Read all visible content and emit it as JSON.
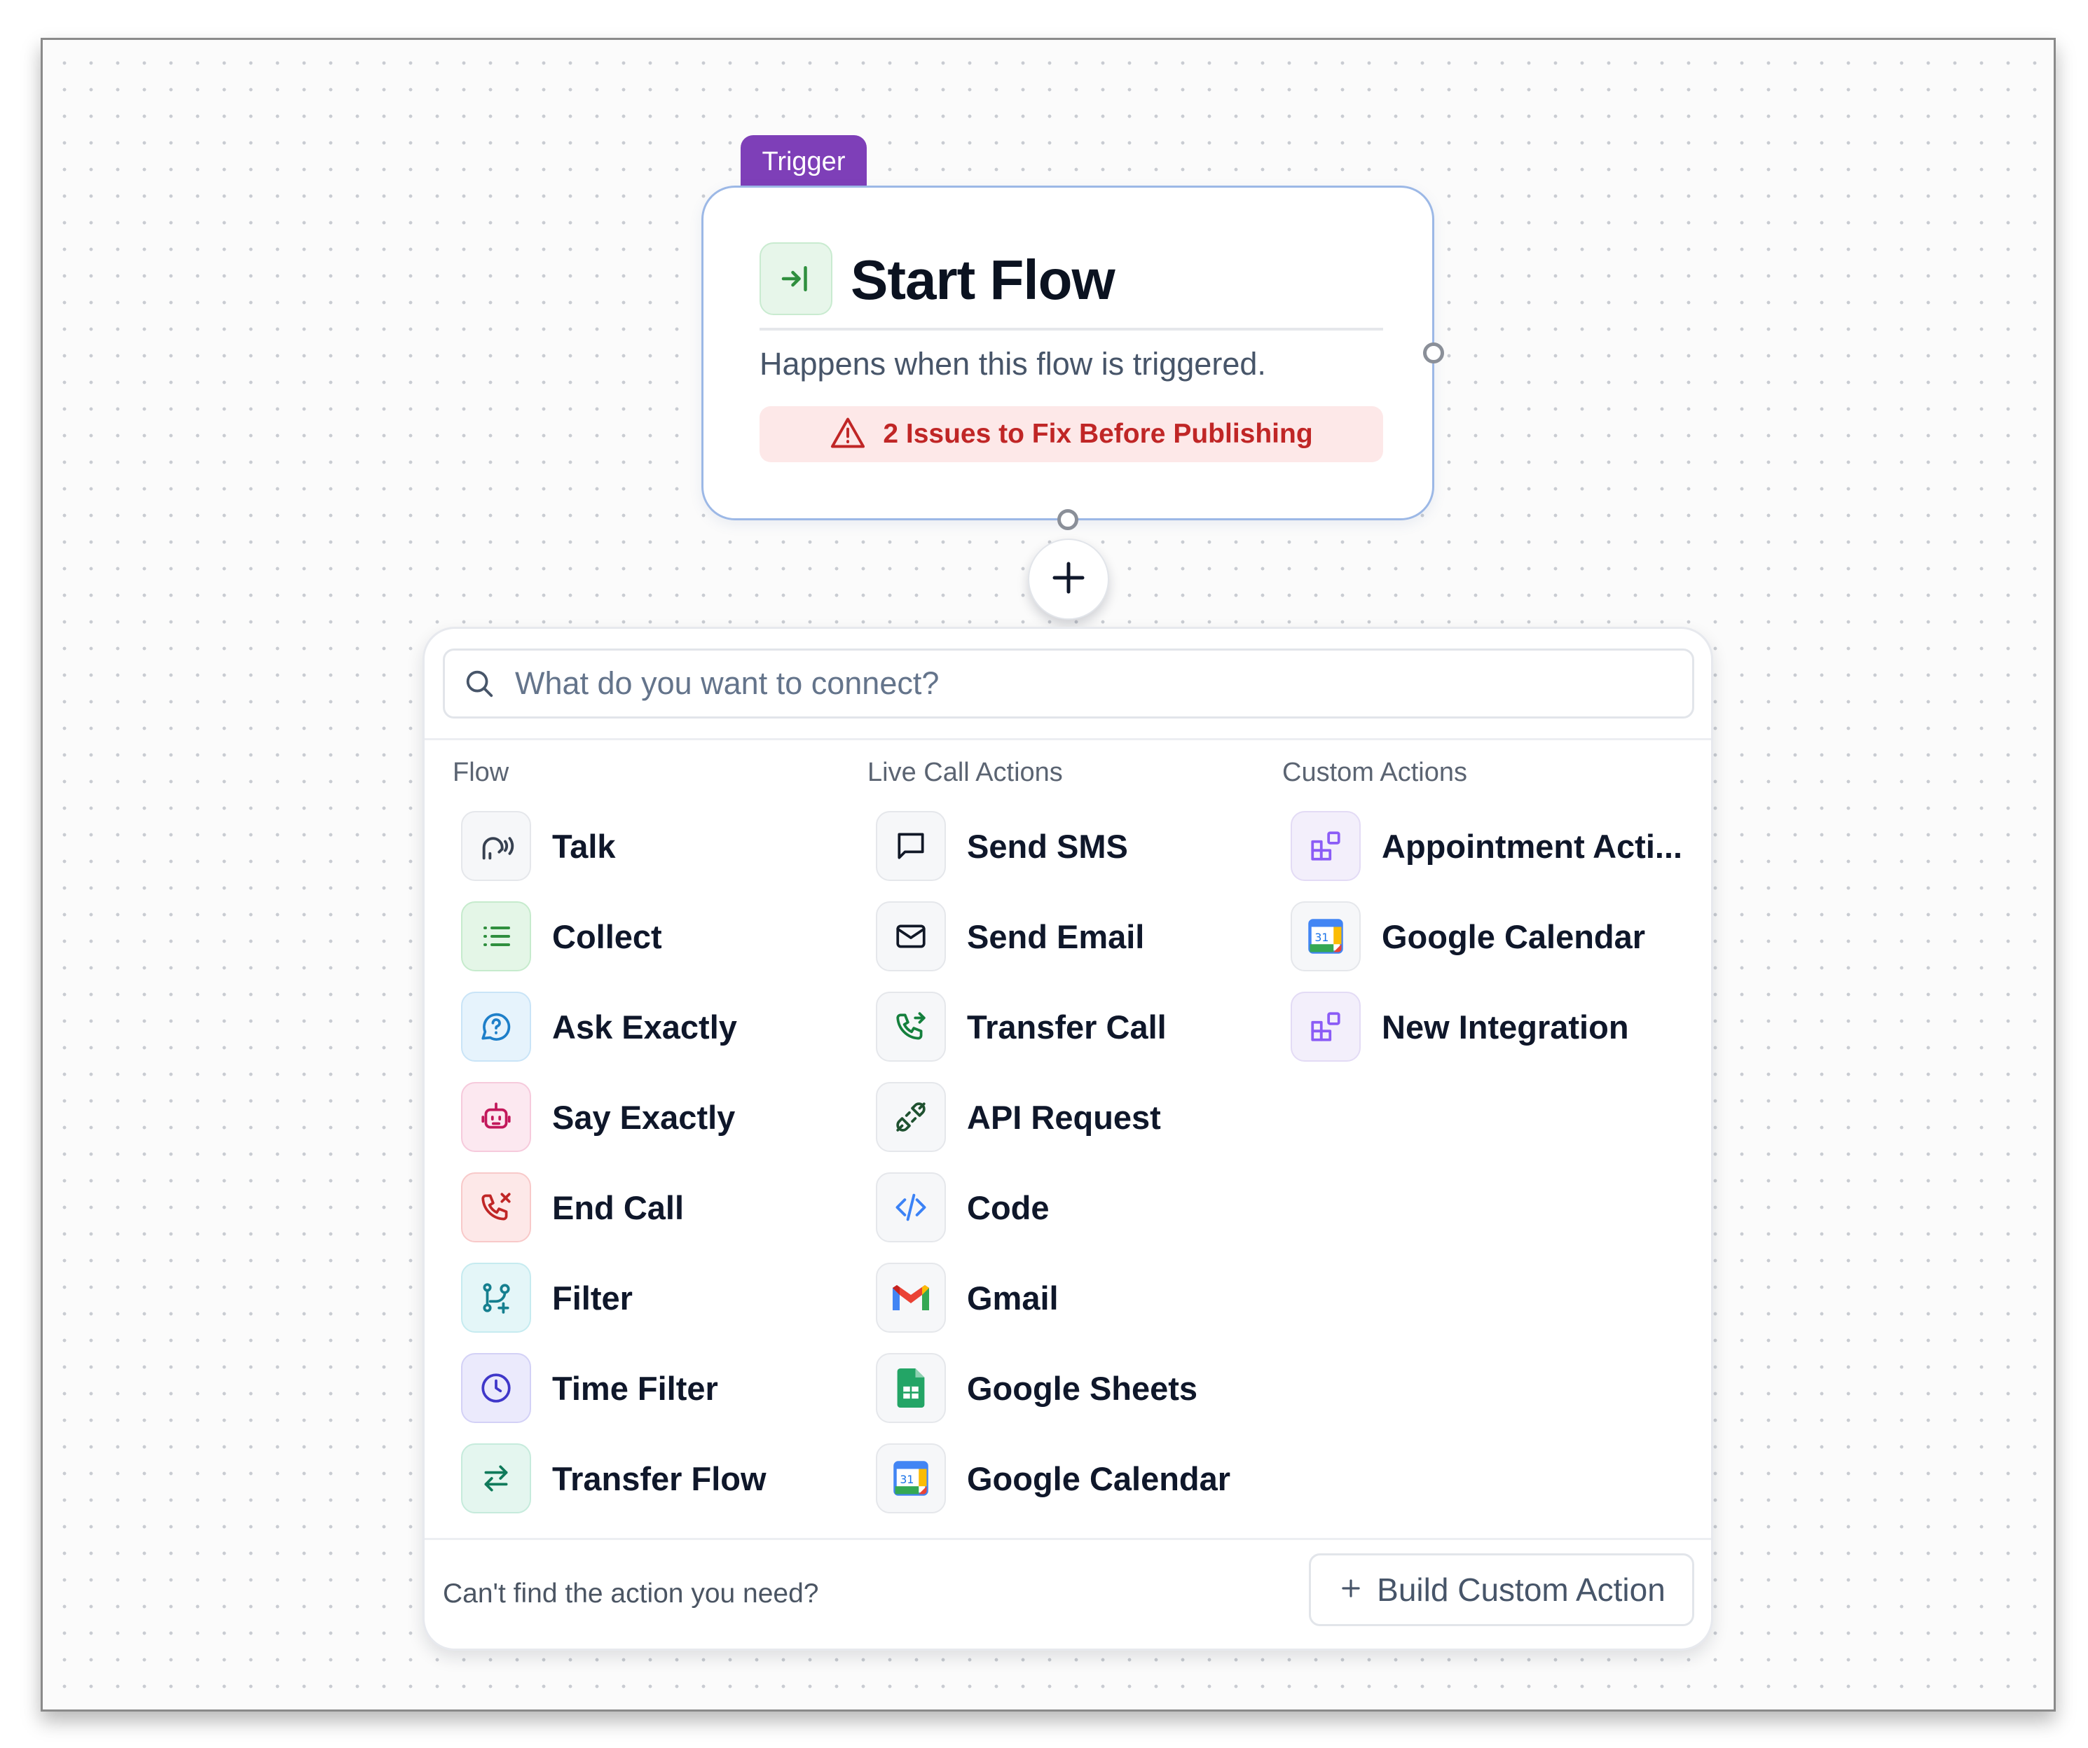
{
  "trigger": {
    "tag_label": "Trigger",
    "title": "Start Flow",
    "description": "Happens when this flow is triggered.",
    "issues_text": "2 Issues to Fix Before Publishing",
    "icon": "enter-arrow-icon"
  },
  "connect_panel": {
    "search_placeholder": "What do you want to connect?",
    "columns": [
      {
        "header": "Flow",
        "items": [
          {
            "label": "Talk",
            "icon": "voice-head-icon"
          },
          {
            "label": "Collect",
            "icon": "list-icon"
          },
          {
            "label": "Ask Exactly",
            "icon": "question-bubble-icon"
          },
          {
            "label": "Say Exactly",
            "icon": "robot-icon"
          },
          {
            "label": "End Call",
            "icon": "phone-x-icon"
          },
          {
            "label": "Filter",
            "icon": "branch-icon"
          },
          {
            "label": "Time Filter",
            "icon": "clock-icon"
          },
          {
            "label": "Transfer Flow",
            "icon": "swap-arrows-icon"
          }
        ]
      },
      {
        "header": "Live Call Actions",
        "items": [
          {
            "label": "Send SMS",
            "icon": "message-square-icon"
          },
          {
            "label": "Send Email",
            "icon": "envelope-icon"
          },
          {
            "label": "Transfer Call",
            "icon": "phone-forward-icon"
          },
          {
            "label": "API Request",
            "icon": "plug-icon"
          },
          {
            "label": "Code",
            "icon": "code-icon"
          },
          {
            "label": "Gmail",
            "icon": "gmail-icon"
          },
          {
            "label": "Google Sheets",
            "icon": "google-sheets-icon"
          },
          {
            "label": "Google Calendar",
            "icon": "google-calendar-icon"
          }
        ]
      },
      {
        "header": "Custom Actions",
        "items": [
          {
            "label": "Appointment Acti...",
            "icon": "integration-blocks-icon"
          },
          {
            "label": "Google Calendar",
            "icon": "google-calendar-icon"
          },
          {
            "label": "New Integration",
            "icon": "integration-blocks-icon"
          }
        ]
      }
    ],
    "footer_text": "Can't find the action you need?",
    "build_button_label": "Build Custom Action"
  },
  "colors": {
    "trigger_tag": "#7e3fb8",
    "issue_red": "#c02626",
    "issue_bg": "#fde8e8",
    "node_border": "#9cb8e6"
  }
}
